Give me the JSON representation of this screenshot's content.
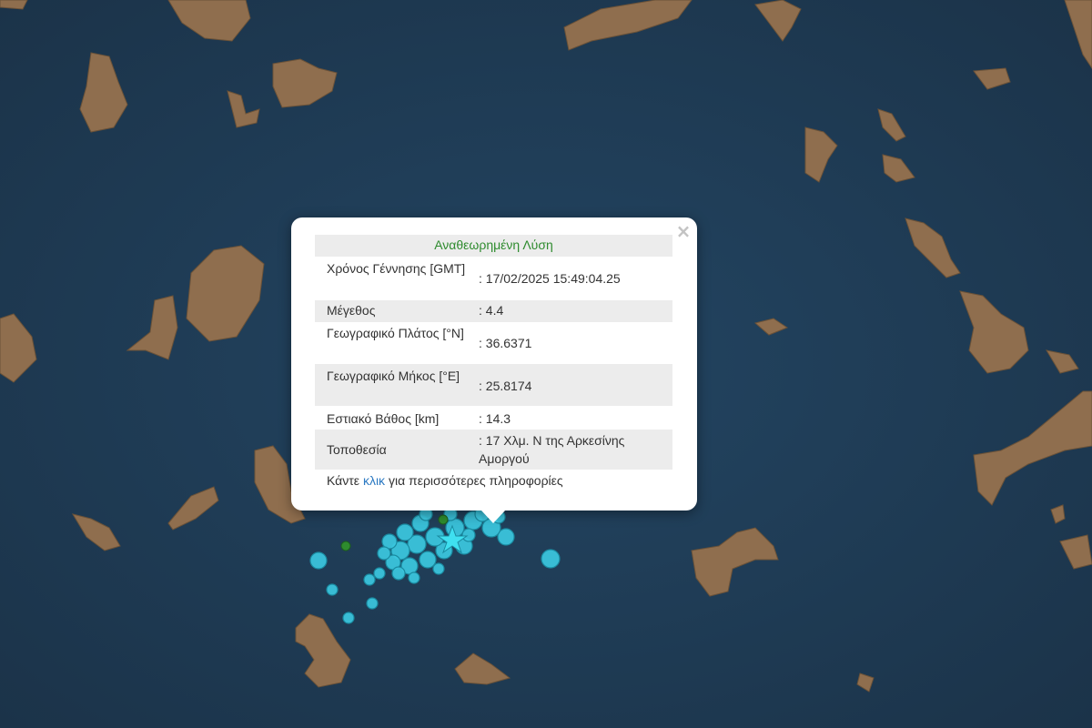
{
  "map": {
    "colors": {
      "sea": "#1f3a52",
      "land": "#8a6a4a",
      "quake": "#3cc8e0",
      "quake_edge": "#1a8aa0",
      "older_quake": "#2e8b2e"
    },
    "main_event_icon": "star-icon"
  },
  "popup": {
    "title": "Αναθεωρημένη Λύση",
    "rows": [
      {
        "label": "Χρόνος Γέννησης [GMT]",
        "value": ": 17/02/2025 15:49:04.25"
      },
      {
        "label": "Μέγεθος",
        "value": ": 4.4"
      },
      {
        "label": "Γεωγραφικό Πλάτος [°N]",
        "value": ": 36.6371"
      },
      {
        "label": "Γεωγραφικό Μήκος [°E]",
        "value": ": 25.8174"
      },
      {
        "label": "Εστιακό Βάθος [km]",
        "value": ": 14.3"
      },
      {
        "label": "Τοποθεσία",
        "value": ": 17 Χλμ. N της Αρκεσίνης Αμοργού"
      }
    ],
    "more_prefix": "Κάντε",
    "more_link": "κλικ",
    "more_suffix": "για περισσότερες πληροφορίες",
    "close_symbol": "×"
  }
}
